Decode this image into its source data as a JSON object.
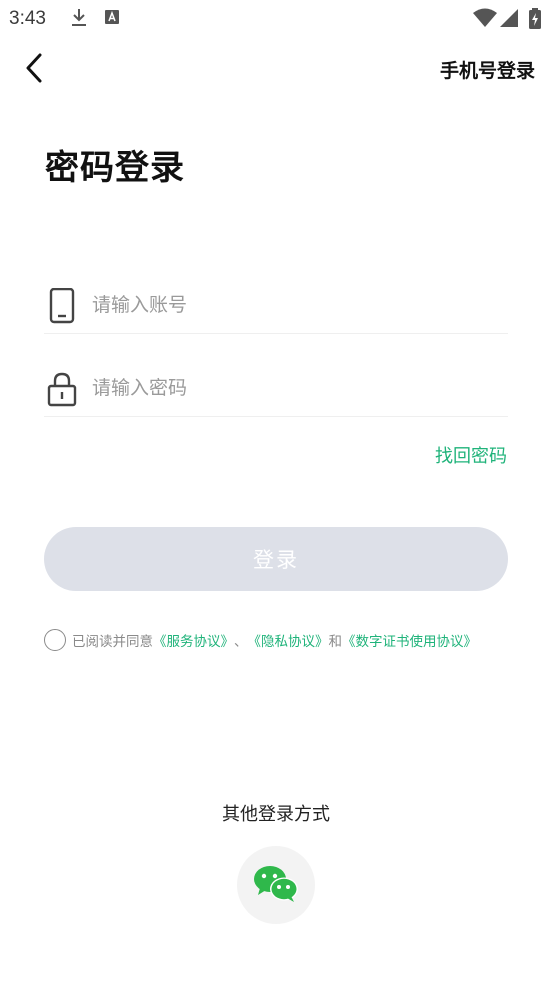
{
  "status_bar": {
    "time": "3:43",
    "icons": [
      "download-icon",
      "text-a-icon",
      "wifi-icon",
      "cellular-signal-icon",
      "battery-charging-icon"
    ]
  },
  "nav": {
    "back_icon": "chevron-left-icon",
    "switch_label": "手机号登录"
  },
  "title": "密码登录",
  "form": {
    "account_placeholder": "请输入账号",
    "account_icon": "phone-icon",
    "password_placeholder": "请输入密码",
    "password_icon": "lock-icon",
    "forgot_label": "找回密码",
    "login_label": "登录"
  },
  "agreement": {
    "prefix": "已阅读并同意",
    "service": "《服务协议》",
    "sep1": "、",
    "privacy": "《隐私协议》",
    "and": "和",
    "cert": "《数字证书使用协议》"
  },
  "other_login": {
    "title": "其他登录方式",
    "wechat_icon": "wechat-icon"
  },
  "colors": {
    "accent": "#1fb37a",
    "button_disabled": "#dde0e8",
    "wechat": "#2fb84b"
  }
}
